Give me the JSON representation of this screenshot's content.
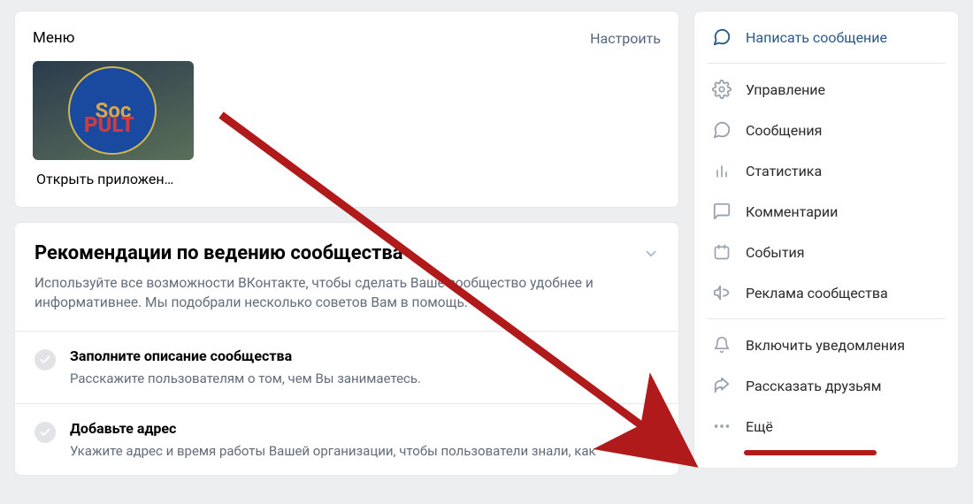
{
  "menu": {
    "title": "Меню",
    "configure": "Настроить",
    "app": {
      "thumb_top": "Soc",
      "thumb_bottom": "PULT",
      "label": "Открыть приложен…"
    }
  },
  "recommendations": {
    "title": "Рекомендации по ведению сообщества",
    "subtitle": "Используйте все возможности ВКонтакте, чтобы сделать Ваше сообщество удобнее и информативнее. Мы подобрали несколько советов Вам в помощь.",
    "items": [
      {
        "title": "Заполните описание сообщества",
        "sub": "Расскажите пользователям о том, чем Вы занимаетесь."
      },
      {
        "title": "Добавьте адрес",
        "sub": "Укажите адрес и время работы Вашей организации, чтобы пользователи знали, как"
      }
    ]
  },
  "sidebar": {
    "write_message": "Написать сообщение",
    "group1": [
      {
        "icon": "gear-icon",
        "label": "Управление"
      },
      {
        "icon": "message-icon",
        "label": "Сообщения"
      },
      {
        "icon": "stats-icon",
        "label": "Статистика"
      },
      {
        "icon": "comment-icon",
        "label": "Комментарии"
      },
      {
        "icon": "calendar-icon",
        "label": "События"
      },
      {
        "icon": "megaphone-icon",
        "label": "Реклама сообщества"
      }
    ],
    "group2": [
      {
        "icon": "bell-icon",
        "label": "Включить уведомления"
      },
      {
        "icon": "share-icon",
        "label": "Рассказать друзьям"
      },
      {
        "icon": "more-icon",
        "label": "Ещё"
      }
    ]
  }
}
